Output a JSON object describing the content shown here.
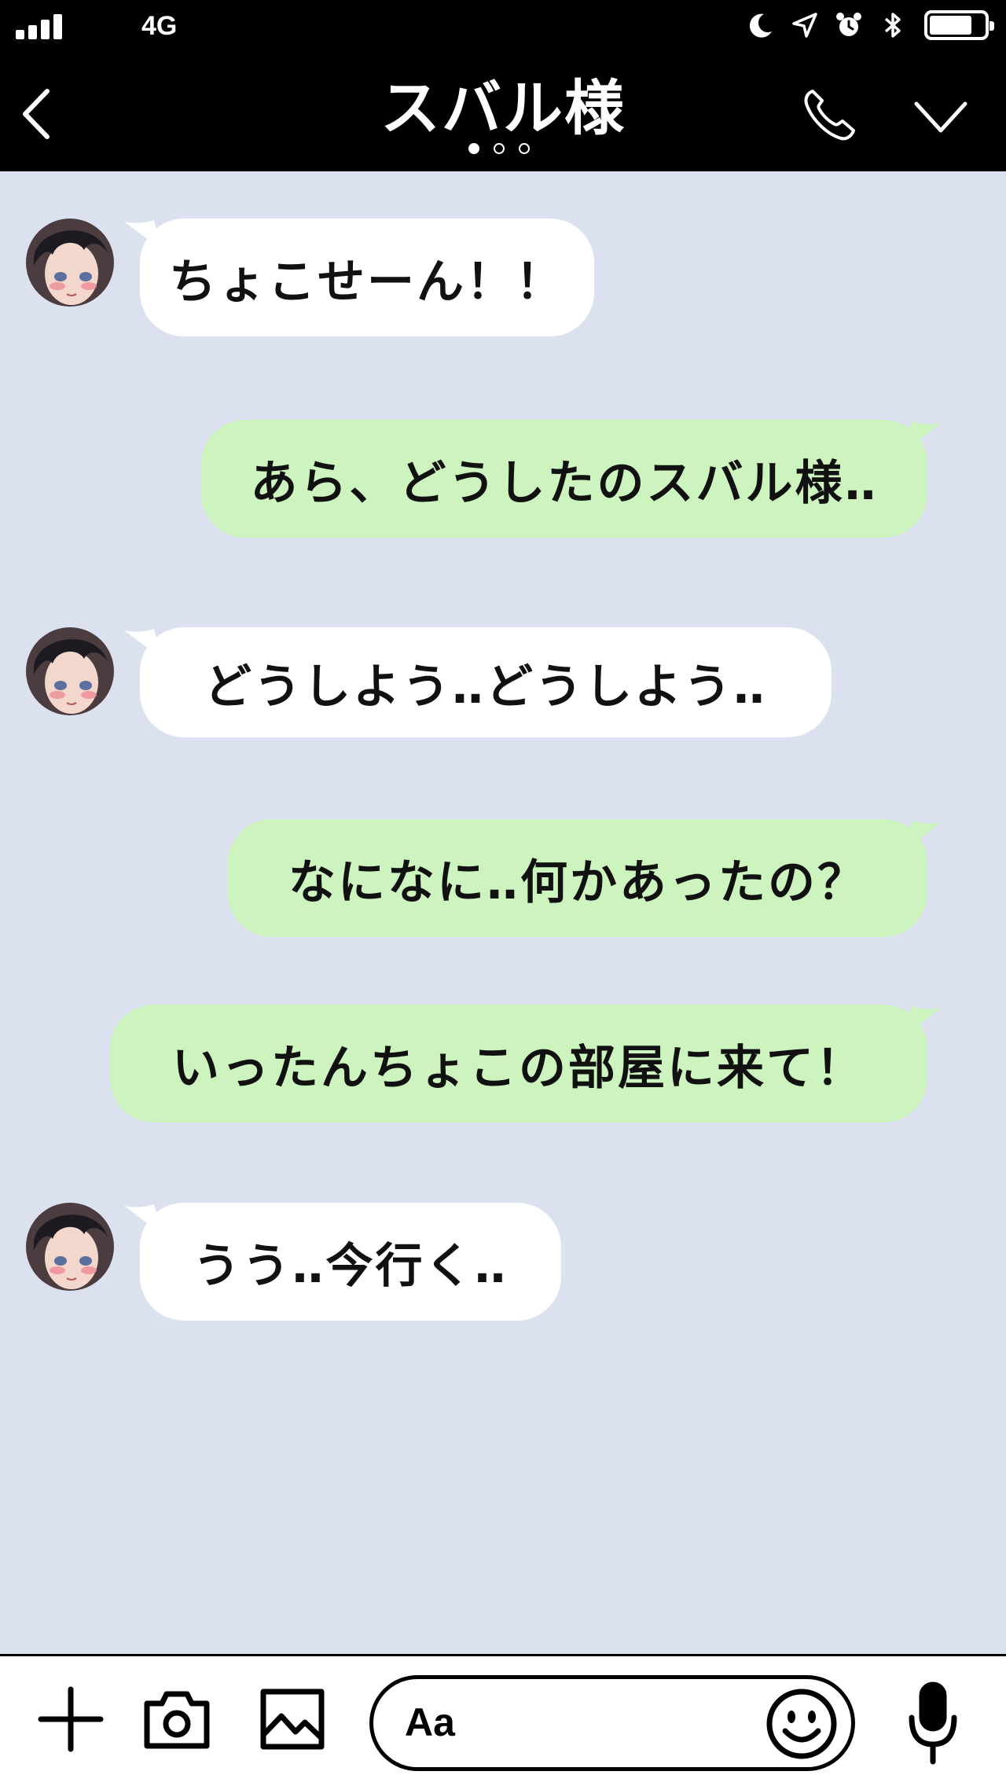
{
  "status_bar": {
    "network": "4G",
    "icons": [
      "signal-bars-icon",
      "moon-icon",
      "location-arrow-icon",
      "alarm-clock-icon",
      "bluetooth-icon",
      "battery-icon"
    ],
    "battery_level": 0.75
  },
  "header": {
    "title": "スバル様",
    "page_dots": 3,
    "active_dot": 0,
    "icons": [
      "back-chevron-icon",
      "phone-icon",
      "chevron-down-icon"
    ]
  },
  "colors": {
    "header_bg": "#000000",
    "chat_bg": "#dbe1ef",
    "incoming_bubble": "#ffffff",
    "outgoing_bubble": "#cdf4bf",
    "text": "#111111"
  },
  "messages": [
    {
      "from": "them",
      "text": "ちょこせーん！！"
    },
    {
      "from": "me",
      "text": "あら、どうしたのスバル様‥"
    },
    {
      "from": "them",
      "text": "どうしよう‥どうしよう‥"
    },
    {
      "from": "me",
      "text": "なになに‥何かあったの？"
    },
    {
      "from": "me",
      "text": "いったんちょこの部屋に来て！"
    },
    {
      "from": "them",
      "text": "うう‥今行く‥"
    }
  ],
  "input_bar": {
    "placeholder": "Aa",
    "icons": [
      "plus-icon",
      "camera-icon",
      "image-icon",
      "smiley-icon",
      "microphone-icon"
    ]
  }
}
